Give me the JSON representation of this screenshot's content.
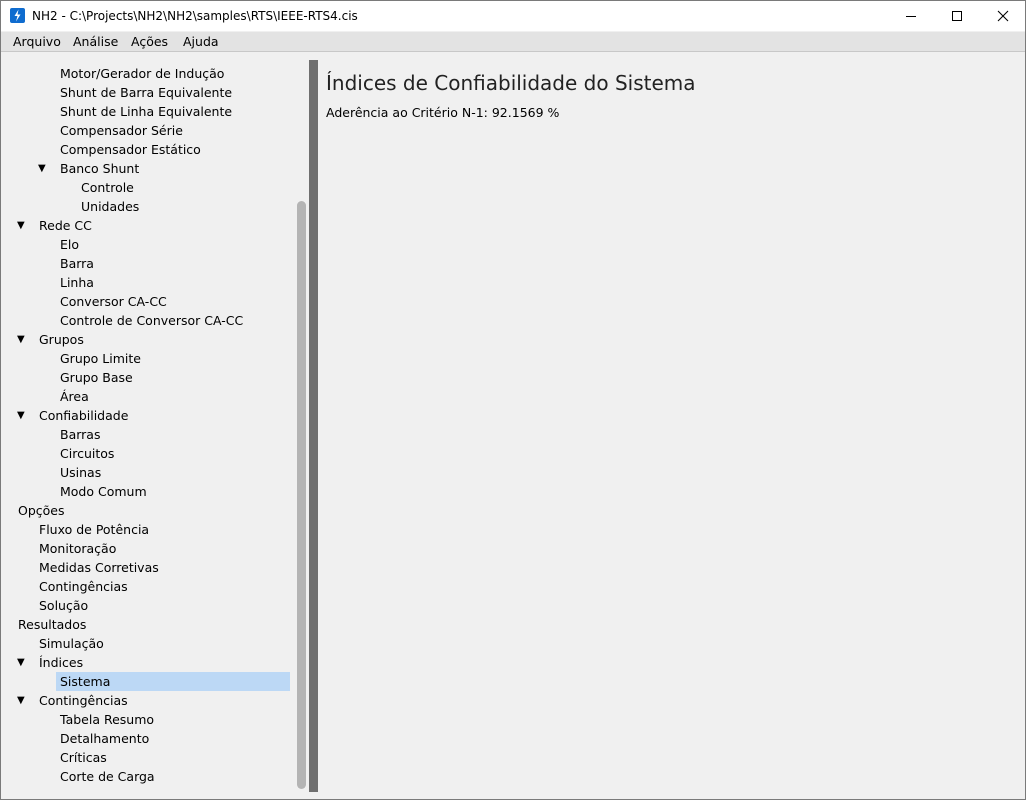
{
  "window": {
    "title": "NH2 - C:\\Projects\\NH2\\NH2\\samples\\RTS\\IEEE-RTS4.cis",
    "icon": "lightning-icon"
  },
  "menu": [
    "Arquivo",
    "Análise",
    "Ações",
    "Ajuda"
  ],
  "tree": [
    {
      "label": "Motor/Gerador de Indução",
      "indent": 2,
      "expanded": null
    },
    {
      "label": "Shunt de Barra Equivalente",
      "indent": 2,
      "expanded": null
    },
    {
      "label": "Shunt de Linha Equivalente",
      "indent": 2,
      "expanded": null
    },
    {
      "label": "Compensador Série",
      "indent": 2,
      "expanded": null
    },
    {
      "label": "Compensador Estático",
      "indent": 2,
      "expanded": null
    },
    {
      "label": "Banco Shunt",
      "indent": 2,
      "expanded": true
    },
    {
      "label": "Controle",
      "indent": 3,
      "expanded": null
    },
    {
      "label": "Unidades",
      "indent": 3,
      "expanded": null
    },
    {
      "label": "Rede CC",
      "indent": 1,
      "expanded": true
    },
    {
      "label": "Elo",
      "indent": 2,
      "expanded": null
    },
    {
      "label": "Barra",
      "indent": 2,
      "expanded": null
    },
    {
      "label": "Linha",
      "indent": 2,
      "expanded": null
    },
    {
      "label": "Conversor CA-CC",
      "indent": 2,
      "expanded": null
    },
    {
      "label": "Controle de Conversor CA-CC",
      "indent": 2,
      "expanded": null
    },
    {
      "label": "Grupos",
      "indent": 1,
      "expanded": true
    },
    {
      "label": "Grupo Limite",
      "indent": 2,
      "expanded": null
    },
    {
      "label": "Grupo Base",
      "indent": 2,
      "expanded": null
    },
    {
      "label": "Área",
      "indent": 2,
      "expanded": null
    },
    {
      "label": "Confiabilidade",
      "indent": 1,
      "expanded": true
    },
    {
      "label": "Barras",
      "indent": 2,
      "expanded": null
    },
    {
      "label": "Circuitos",
      "indent": 2,
      "expanded": null
    },
    {
      "label": "Usinas",
      "indent": 2,
      "expanded": null
    },
    {
      "label": "Modo Comum",
      "indent": 2,
      "expanded": null
    },
    {
      "label": "Opções",
      "indent": 0,
      "expanded": true
    },
    {
      "label": "Fluxo de Potência",
      "indent": 1,
      "expanded": null
    },
    {
      "label": "Monitoração",
      "indent": 1,
      "expanded": null
    },
    {
      "label": "Medidas Corretivas",
      "indent": 1,
      "expanded": null
    },
    {
      "label": "Contingências",
      "indent": 1,
      "expanded": null
    },
    {
      "label": "Solução",
      "indent": 1,
      "expanded": null
    },
    {
      "label": "Resultados",
      "indent": 0,
      "expanded": true
    },
    {
      "label": "Simulação",
      "indent": 1,
      "expanded": null
    },
    {
      "label": "Índices",
      "indent": 1,
      "expanded": true
    },
    {
      "label": "Sistema",
      "indent": 2,
      "expanded": null,
      "selected": true
    },
    {
      "label": "Contingências",
      "indent": 1,
      "expanded": true
    },
    {
      "label": "Tabela Resumo",
      "indent": 2,
      "expanded": null
    },
    {
      "label": "Detalhamento",
      "indent": 2,
      "expanded": null
    },
    {
      "label": "Críticas",
      "indent": 2,
      "expanded": null
    },
    {
      "label": "Corte de Carga",
      "indent": 2,
      "expanded": null
    }
  ],
  "content": {
    "title": "Índices de Confiabilidade do Sistema",
    "metric": "Aderência ao Critério N-1: 92.1569 %"
  },
  "colors": {
    "selection": "#bcd8f5",
    "splitter": "#6f6f6f",
    "app_icon": "#0f6ccf"
  }
}
